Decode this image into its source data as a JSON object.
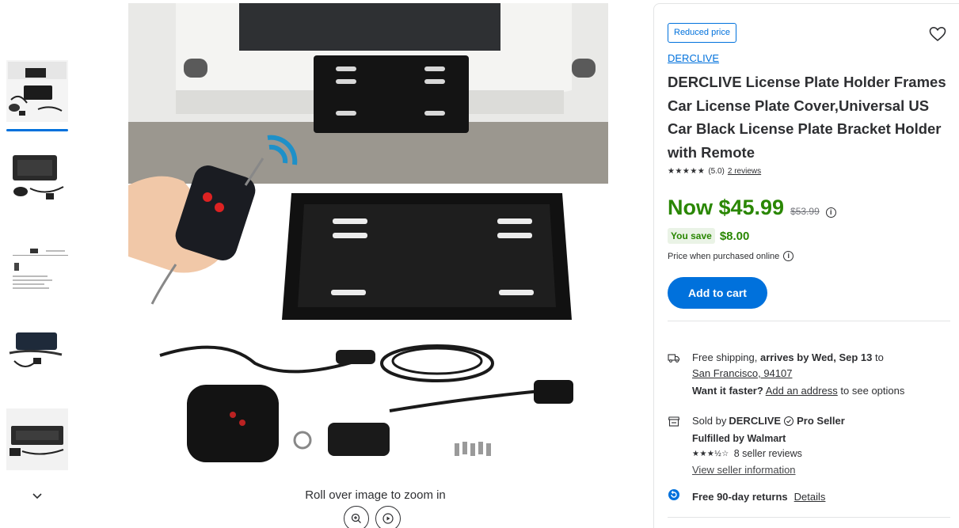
{
  "gallery": {
    "thumbnail_count": 5,
    "zoom_hint": "Roll over image to zoom in"
  },
  "product": {
    "badge": "Reduced price",
    "brand": "DERCLIVE",
    "title": "DERCLIVE License Plate Holder Frames Car License Plate Cover,Universal US Car Black License Plate Bracket Holder with Remote",
    "rating_stars": "★★★★★",
    "rating_value": "(5.0)",
    "reviews_link": "2 reviews"
  },
  "price": {
    "now": "Now $45.99",
    "was": "$53.99",
    "save_label": "You save",
    "save_amount": "$8.00",
    "note": "Price when purchased online",
    "info_glyph": "i"
  },
  "cart": {
    "add_label": "Add to cart"
  },
  "shipping": {
    "prefix": "Free shipping, ",
    "arrives": "arrives by Wed, Sep 13",
    "to": " to",
    "location": "San Francisco, 94107",
    "faster_label": "Want it faster?",
    "add_address": "Add an address",
    "faster_suffix": "to see options"
  },
  "seller": {
    "sold_prefix": "Sold by",
    "name": "DERCLIVE",
    "pro": "Pro Seller",
    "fulfilled": "Fulfilled by Walmart",
    "stars": "★★★½☆",
    "reviews": "8 seller reviews",
    "info_link": "View seller information"
  },
  "returns": {
    "label": "Free 90-day returns",
    "details": "Details"
  },
  "colors": {
    "accent": "#0071dc",
    "price_green": "#2a8703",
    "text": "#2e2f32"
  },
  "icons": [
    "chevron-down-icon",
    "zoom-in-icon",
    "play-icon",
    "heart-icon",
    "info-icon",
    "truck-icon",
    "store-icon",
    "verified-badge-icon",
    "returns-icon"
  ]
}
